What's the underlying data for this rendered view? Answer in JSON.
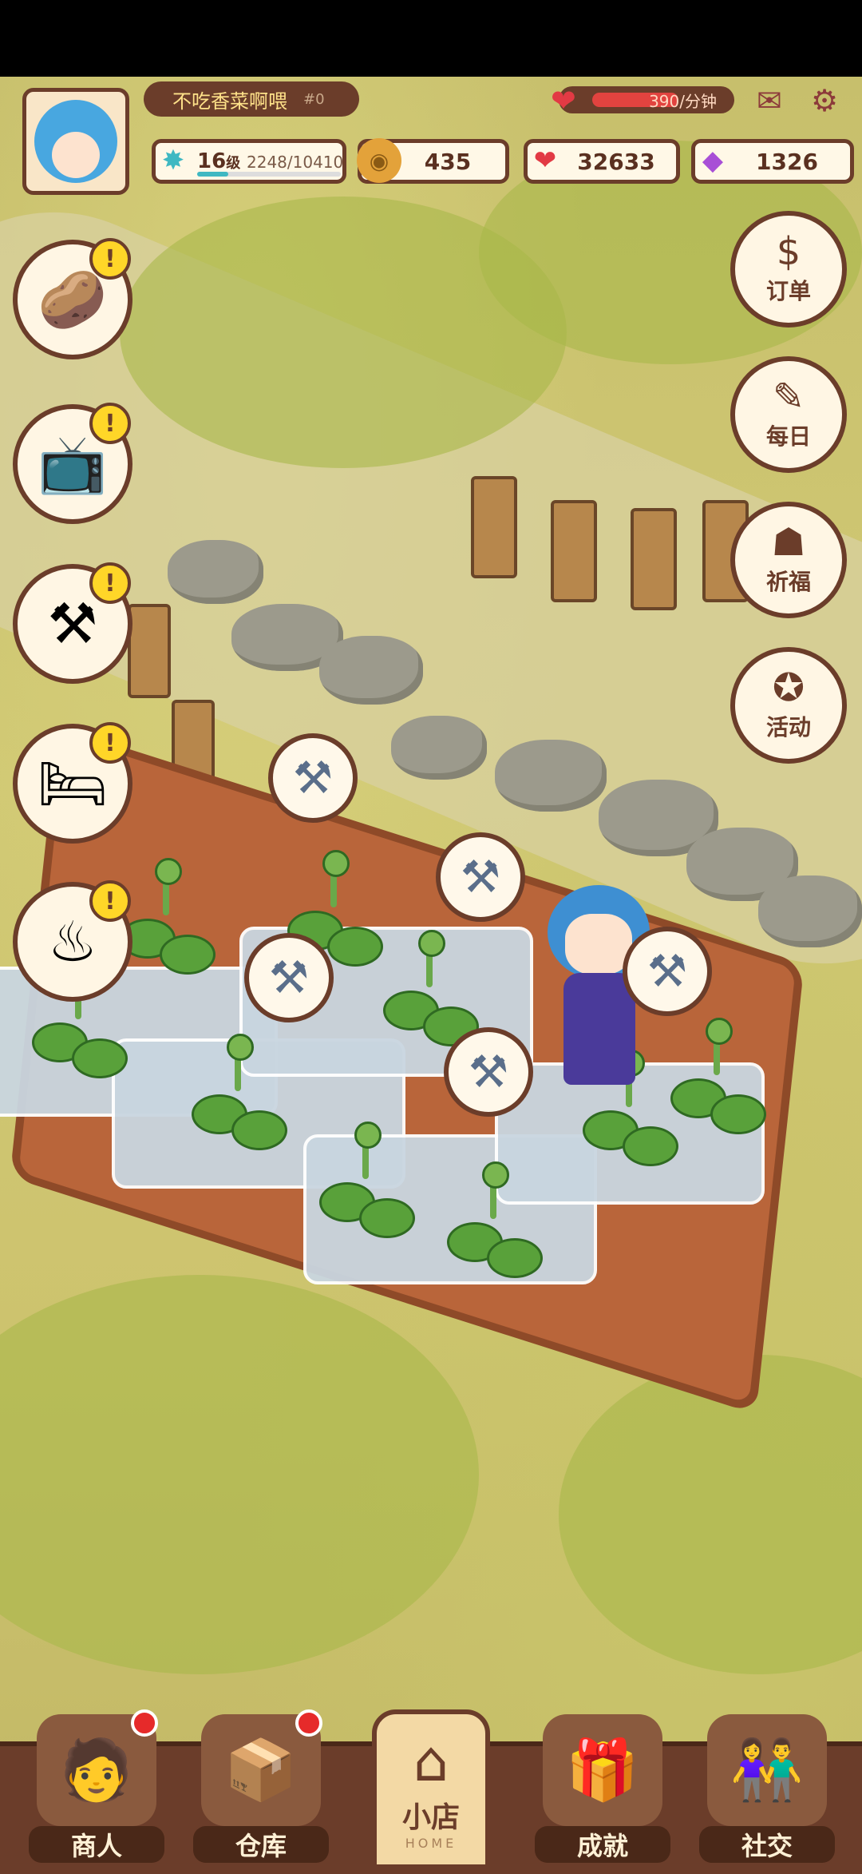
{
  "player": {
    "name": "不吃香菜啊喂",
    "id": "#0",
    "level_num": "16",
    "level_unit": "级",
    "xp_text": "2248/10410",
    "xp_progress": 0.216
  },
  "rate": {
    "text": "390/分钟"
  },
  "resources": {
    "gold": "435",
    "hearts": "32633",
    "gems": "1326"
  },
  "right_menu": [
    {
      "label": "订单",
      "icon": "order-book-icon",
      "glyph": "$"
    },
    {
      "label": "每日",
      "icon": "daily-notebook-icon",
      "glyph": "✎"
    },
    {
      "label": "祈福",
      "icon": "pray-icon",
      "glyph": "☗"
    },
    {
      "label": "活动",
      "icon": "balloon-icon",
      "glyph": "✪"
    }
  ],
  "left_menu": [
    {
      "icon": "potato-icon",
      "glyph": "🥔",
      "badge": "!"
    },
    {
      "icon": "tv-icon",
      "glyph": "📺",
      "badge": "!"
    },
    {
      "icon": "workbench-icon",
      "glyph": "⚒",
      "badge": "!"
    },
    {
      "icon": "bed-icon",
      "glyph": "🛏",
      "badge": "!"
    },
    {
      "icon": "shop-sign-icon",
      "glyph": "♨",
      "badge": "!"
    }
  ],
  "bottom_nav": {
    "merchant": "商人",
    "warehouse": "仓库",
    "home": "小店",
    "home_sub": "HOME",
    "achievement": "成就",
    "social": "社交"
  },
  "colors": {
    "frame": "#6b3d2a",
    "badge": "#ffd628",
    "grass": "#c7bf6c",
    "soil": "#b9653a"
  }
}
